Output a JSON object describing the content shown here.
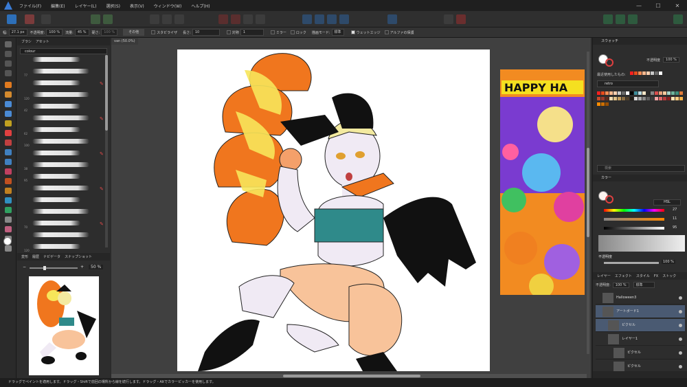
{
  "menu": [
    "ファイル(F)",
    "編集(E)",
    "レイヤー(L)",
    "選択(S)",
    "表示(V)",
    "ウィンドウ(W)",
    "ヘルプ(H)"
  ],
  "window_controls": [
    "—",
    "☐",
    "✕"
  ],
  "context": {
    "width_label": "幅:",
    "width_value": "27.1 px",
    "opacity_label": "不透明度:",
    "opacity_value": "100 %",
    "flow_label": "流量:",
    "flow_value": "45 %",
    "hardness_label": "硬さ:",
    "hardness_value": "100 %",
    "more_button": "その他",
    "stabilizer_label": "スタビライザ",
    "length_label": "長さ:",
    "length_value": "10",
    "symmetry_label": "対称",
    "symmetry_value": "1",
    "mirror_label": "ミラー",
    "lock_label": "ロック",
    "blend_label": "描画モード:",
    "blend_value": "標準",
    "wet_edges_label": "ウェットエッジ",
    "protect_alpha_label": "アルファの保護"
  },
  "brush_panel": {
    "tabs": [
      "ブラシ",
      "アセット"
    ],
    "category": "colour",
    "sizes": [
      "",
      "77",
      "",
      "120",
      "42",
      "",
      "62",
      "100",
      "",
      "38",
      "95",
      "",
      "",
      "",
      "70",
      "",
      "120"
    ]
  },
  "nav_panel": {
    "tabs": [
      "変形",
      "履歴",
      "ナビゲータ",
      "スナップショット"
    ],
    "zoom_value": "50 %"
  },
  "document": {
    "tab_title": "van (50.0%)"
  },
  "reference_image": {
    "title_text": "HAPPY HA"
  },
  "swatches": {
    "header": "スウォッチ",
    "opacity_label": "不透明度",
    "opacity_value": "100 %",
    "recent_label": "最近使用したもの:",
    "palette_name": "retro",
    "search_placeholder": "検索",
    "colors": [
      "#ff1f1f",
      "#e84b1a",
      "#f58c54",
      "#fdb88d",
      "#fdd0b0",
      "#c9c9c9",
      "#6a6a6a",
      "#ffffff",
      "#000000",
      "#3b8c9a",
      "#b8d8e0",
      "#f4e5c7",
      "#2a2a2a",
      "#888888",
      "#d94d4d",
      "#e8a37d",
      "#f6c99c",
      "#a6d4c9",
      "#6bb39b",
      "#3f8f7a",
      "#e07b39",
      "#c84b2b",
      "#9b3a2a",
      "#5c2a1d",
      "#f2dcb2",
      "#e2c28a",
      "#c79f5f",
      "#8b6e43",
      "#4d3d2a",
      "#1e1a14",
      "#d8d8d8",
      "#b0b0b0",
      "#8a8a8a",
      "#5e5e5e",
      "#3c3c3c",
      "#f4a6a6",
      "#e06b6b",
      "#b83b3b",
      "#8a1f1f",
      "#ffe5b4",
      "#ffcc80",
      "#ffb347",
      "#ff8c00",
      "#cc6f00",
      "#994d00"
    ]
  },
  "color_panel": {
    "header": "カラー",
    "model": "HSL",
    "h_value": "27",
    "s_value": "11",
    "l_value": "95",
    "opacity_label": "不透明度",
    "opacity_value": "100 %"
  },
  "layers_panel": {
    "tabs": [
      "レイヤー",
      "エフェクト",
      "スタイル",
      "FX",
      "ストック"
    ],
    "opacity_label": "不透明度:",
    "opacity_value": "100 %",
    "blend_value": "標準",
    "layers": [
      {
        "name": "Halloween3",
        "indent": 0,
        "selected": false
      },
      {
        "name": "アートボード1",
        "indent": 0,
        "selected": true
      },
      {
        "name": "ピクセル",
        "indent": 1,
        "selected": true
      },
      {
        "name": "レイヤー1",
        "indent": 1,
        "selected": false
      },
      {
        "name": "ピクセル",
        "indent": 2,
        "selected": false
      },
      {
        "name": "ピクセル",
        "indent": 2,
        "selected": false
      }
    ]
  },
  "status_bar": {
    "text": "ドラッグでペイントを適用します。ドラッグ・Shiftで前回の場所から線を続行します。ドラッグ・Altでカラーピッカーを使用します。"
  },
  "colors": {
    "accent_blue": "#3a7bd5",
    "hair_orange": "#f0761e",
    "hair_yellow": "#f7e65a",
    "top_teal": "#2f8a8a",
    "skin": "#f0eaf4",
    "legs": "#f8c39a"
  }
}
